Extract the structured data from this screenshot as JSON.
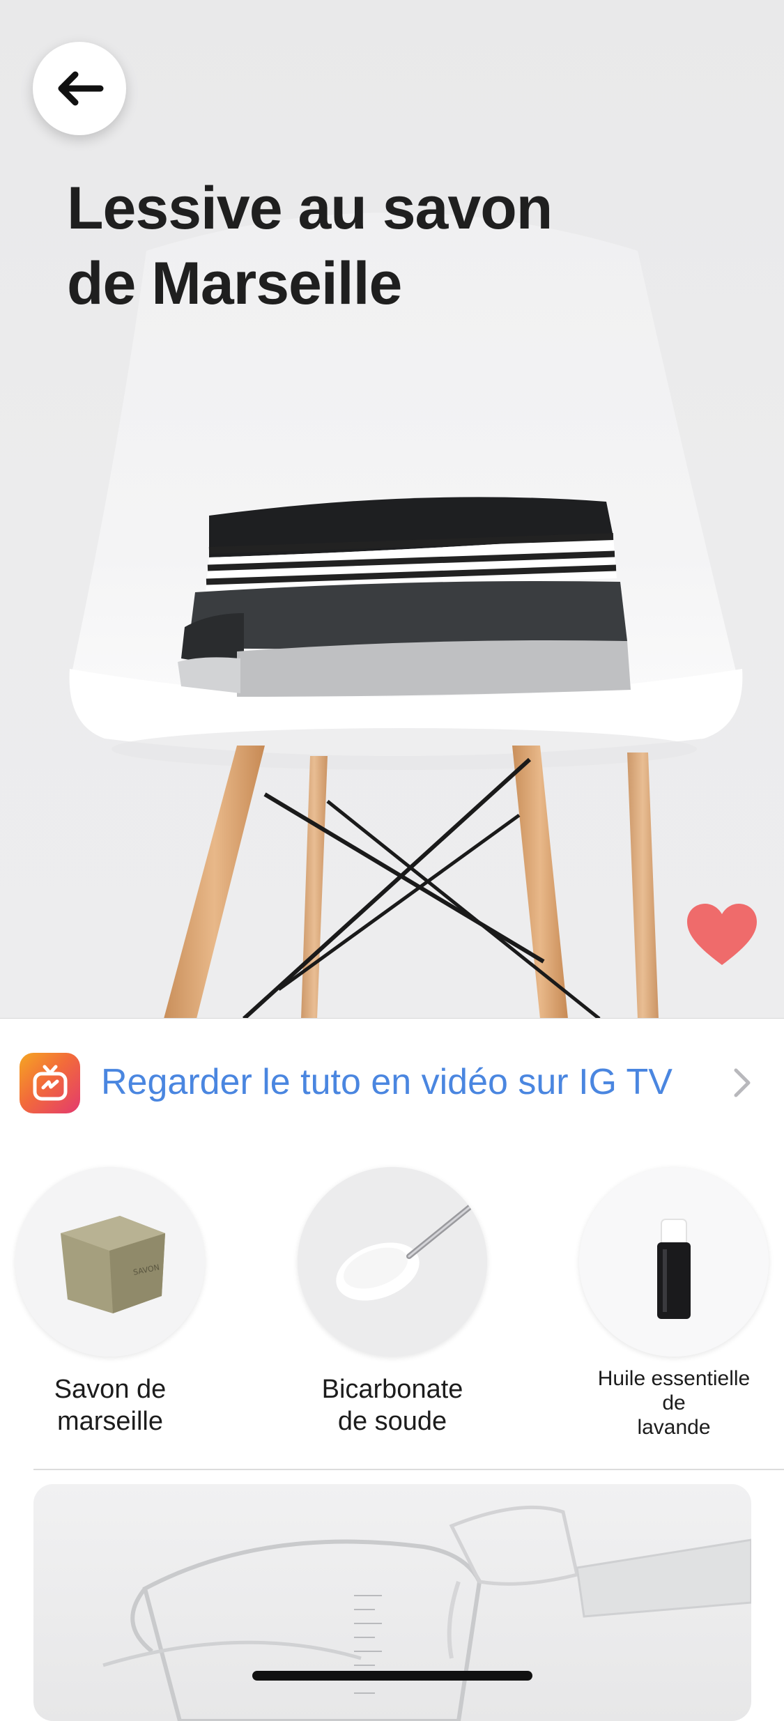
{
  "header": {
    "title_lines": [
      "Lessive au savon",
      "de Marseille"
    ],
    "back_icon": "arrow-left-icon",
    "favorite_icon": "heart-icon",
    "favorite_color": "#ef6b6b"
  },
  "video_link": {
    "icon": "igtv-icon",
    "label": "Regarder le tuto en vidéo sur IG TV",
    "chevron_icon": "chevron-right-icon",
    "color": "#4a86e0"
  },
  "ingredients": [
    {
      "label_lines": [
        "Savon de",
        "marseille"
      ],
      "image": "soap-bar-image"
    },
    {
      "label_lines": [
        "Bicarbonate",
        "de soude"
      ],
      "image": "spoon-baking-soda-image"
    },
    {
      "label_lines": [
        "Huile essentielle",
        "de",
        "lavande"
      ],
      "image": "essential-oil-bottle-image"
    }
  ],
  "step_card": {
    "image": "measuring-jug-image"
  }
}
